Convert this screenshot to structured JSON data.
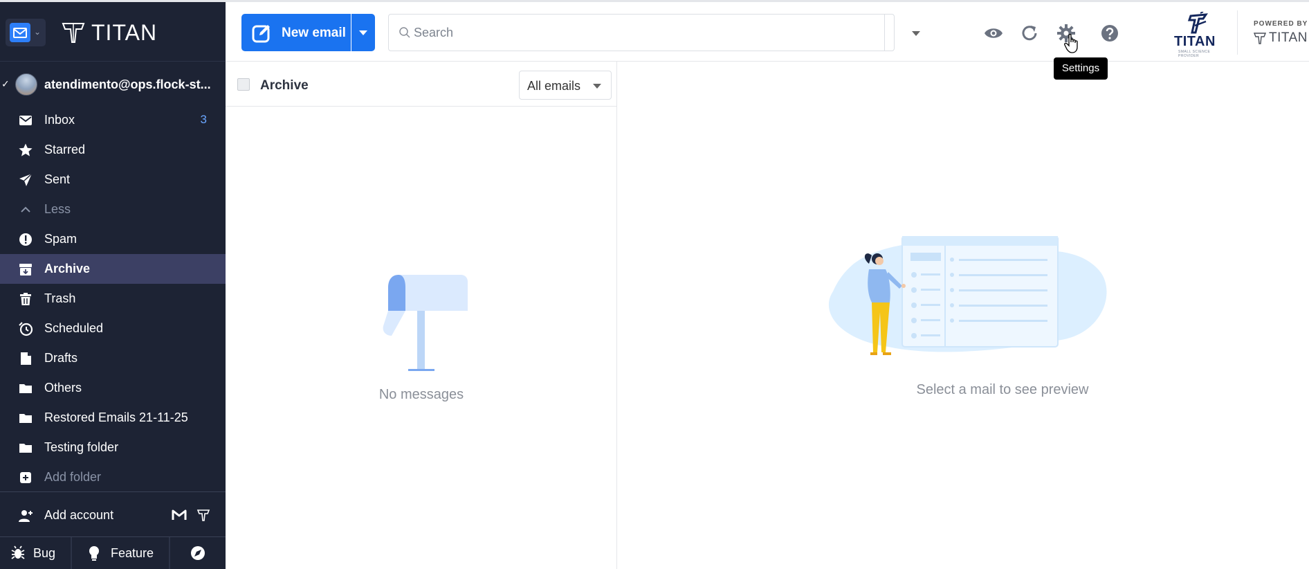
{
  "brand": {
    "name": "TITAN"
  },
  "account": {
    "email": "atendimento@ops.flock-st..."
  },
  "sidebar": {
    "items": [
      {
        "label": "Inbox",
        "count": "3"
      },
      {
        "label": "Starred"
      },
      {
        "label": "Sent"
      },
      {
        "label": "Less"
      },
      {
        "label": "Spam"
      },
      {
        "label": "Archive"
      },
      {
        "label": "Trash"
      },
      {
        "label": "Scheduled"
      },
      {
        "label": "Drafts"
      },
      {
        "label": "Others"
      },
      {
        "label": "Restored Emails 21-11-25"
      },
      {
        "label": "Testing folder"
      },
      {
        "label": "Add folder"
      }
    ],
    "add_account": "Add account",
    "footer": {
      "bug": "Bug",
      "feature": "Feature"
    }
  },
  "toolbar": {
    "new_email": "New email",
    "search_placeholder": "Search",
    "tooltip": "Settings"
  },
  "logo": {
    "word": "TITAN",
    "small_caption": "SMALL SCIENCE PROVIDER"
  },
  "powered_by": {
    "label": "POWERED BY",
    "brand": "TITAN"
  },
  "list": {
    "folder_title": "Archive",
    "filter": "All emails",
    "empty_message": "No messages"
  },
  "preview": {
    "empty_message": "Select a mail to see preview"
  },
  "colors": {
    "sidebar_bg": "#1d2334",
    "accent": "#1a73f0",
    "active_item": "#3c4064",
    "count": "#6aa6ff"
  }
}
